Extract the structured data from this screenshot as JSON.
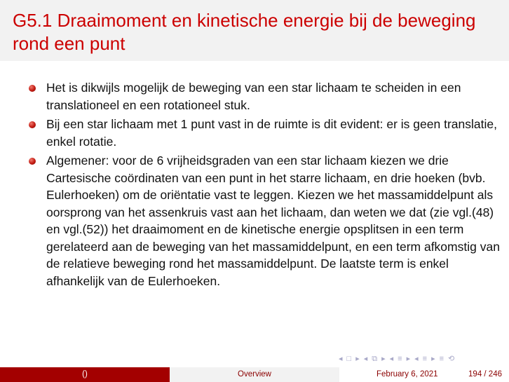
{
  "slide": {
    "title": "G5.1 Draaimoment en kinetische energie bij de beweging rond een punt",
    "bullets": [
      "Het is dikwijls mogelijk de beweging van een star lichaam te scheiden in een translationeel en een rotationeel stuk.",
      "Bij een star lichaam met 1 punt vast in de ruimte is dit evident: er is geen translatie, enkel rotatie.",
      "Algemener: voor de 6 vrijheidsgraden van een star lichaam kiezen we drie Cartesische coördinaten van een punt in het starre lichaam, en drie hoeken (bvb. Eulerhoeken) om de oriëntatie vast te leggen. Kiezen we het massamiddelpunt als oorsprong van het assenkruis vast aan het lichaam, dan weten we dat (zie vgl.(48) en vgl.(52)) het draaimoment en de kinetische energie opsplitsen in een term gerelateerd aan de beweging van het massamiddelpunt, en een term afkomstig van de relatieve beweging rond het massamiddelpunt. De laatste term is enkel afhankelijk van de Eulerhoeken."
    ]
  },
  "footer": {
    "author": "()",
    "section": "Overview",
    "date": "February 6, 2021",
    "page": "194 / 246"
  },
  "nav_icons": [
    "first-frame-icon",
    "prev-frame-icon",
    "next-frame-icon",
    "prev-subsection-icon",
    "next-subsection-icon",
    "prev-section-icon",
    "next-section-icon",
    "align-icon",
    "search-icon"
  ],
  "colors": {
    "title": "#cc0000",
    "bullet": "#c21a12",
    "footer_left_bg": "#a30000",
    "footer_text": "#8b0000"
  }
}
